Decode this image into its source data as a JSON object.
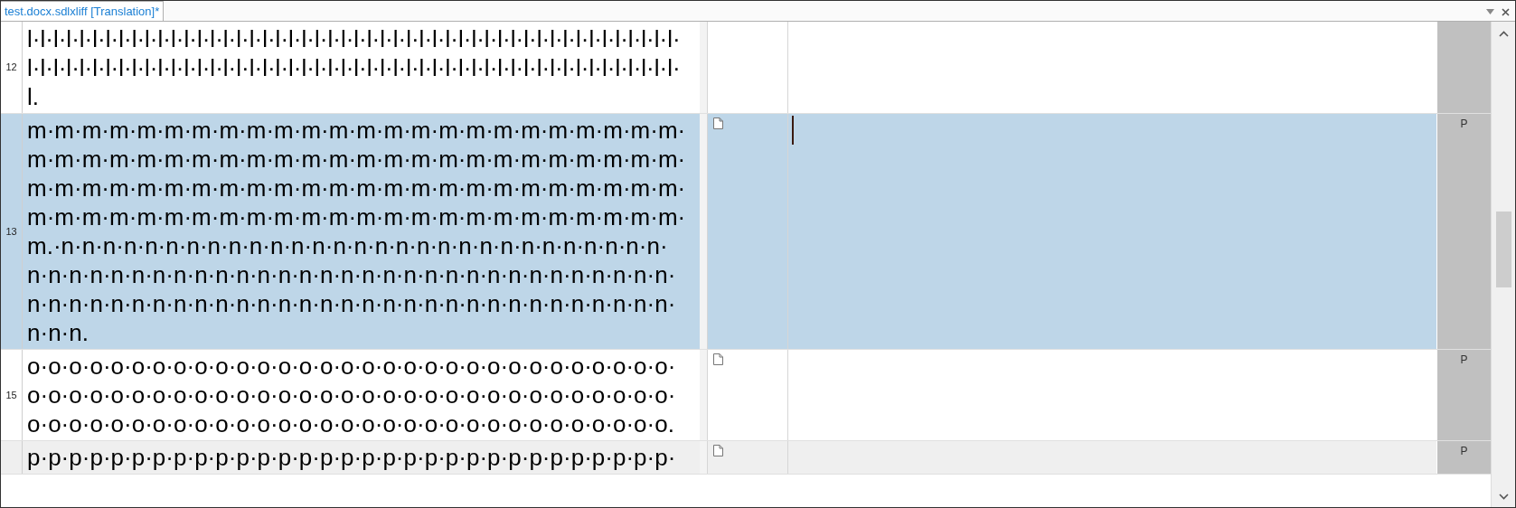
{
  "tab": {
    "label": "test.docx.sdlxliff [Translation]*",
    "selected": true
  },
  "segments": [
    {
      "number": "12",
      "source": "l·l·l·l·l·l·l·l·l·l·l·l·l·l·l·l·l·l·l·l·l·l·l·l·l·l·l·l·l·l·l·l·l·l·l·l·l·l·l·l·l·l·l·l·l·l·l·l·l·l·l·l·l·l·l·l·l·l·l·l·l·l·l·l·l·l·l·l·l·l·l·l·l·l·l·l·l·l·l·l·l·l·l·l·l·l·l·l·l·l·l·l·l·l·l·l·l·l·l·l·l.",
      "selected": false,
      "shaded": false
    },
    {
      "number": "13",
      "source": "m·m·m·m·m·m·m·m·m·m·m·m·m·m·m·m·m·m·m·m·m·m·m·m·m·m·m·m·m·m·m·m·m·m·m·m·m·m·m·m·m·m·m·m·m·m·m·m·m·m·m·m·m·m·m·m·m·m·m·m·m·m·m·m·m·m·m·m·m·m·m·m·m·m·m·m·m·m·m·m·m·m·m·m·m·m·m·m·m·m·m·m·m·m·m·m·m.·n·n·n·n·n·n·n·n·n·n·n·n·n·n·n·n·n·n·n·n·n·n·n·n·n·n·n·n·n·n·n·n·n·n·n·n·n·n·n·n·n·n·n·n·n·n·n·n·n·n·n·n·n·n·n·n·n·n·n·n·n·n·n·n·n·n·n·n·n·n·n·n·n·n·n·n·n·n·n·n·n·n·n·n·n·n·n·n·n·n·n·n·n·n.",
      "status": "P",
      "selected": true,
      "shaded": false
    },
    {
      "number": "15",
      "source": "o·o·o·o·o·o·o·o·o·o·o·o·o·o·o·o·o·o·o·o·o·o·o·o·o·o·o·o·o·o·o·o·o·o·o·o·o·o·o·o·o·o·o·o·o·o·o·o·o·o·o·o·o·o·o·o·o·o·o·o·o·o·o·o·o·o·o·o·o·o·o·o·o·o·o·o·o·o·o·o·o·o·o·o·o·o·o·o·o·o·o·o·o.",
      "status": "P",
      "selected": false,
      "shaded": false
    },
    {
      "source": "p·p·p·p·p·p·p·p·p·p·p·p·p·p·p·p·p·p·p·p·p·p·p·p·p·p·p·p·p·p·p·",
      "status": "P",
      "selected": false,
      "shaded": true
    }
  ]
}
